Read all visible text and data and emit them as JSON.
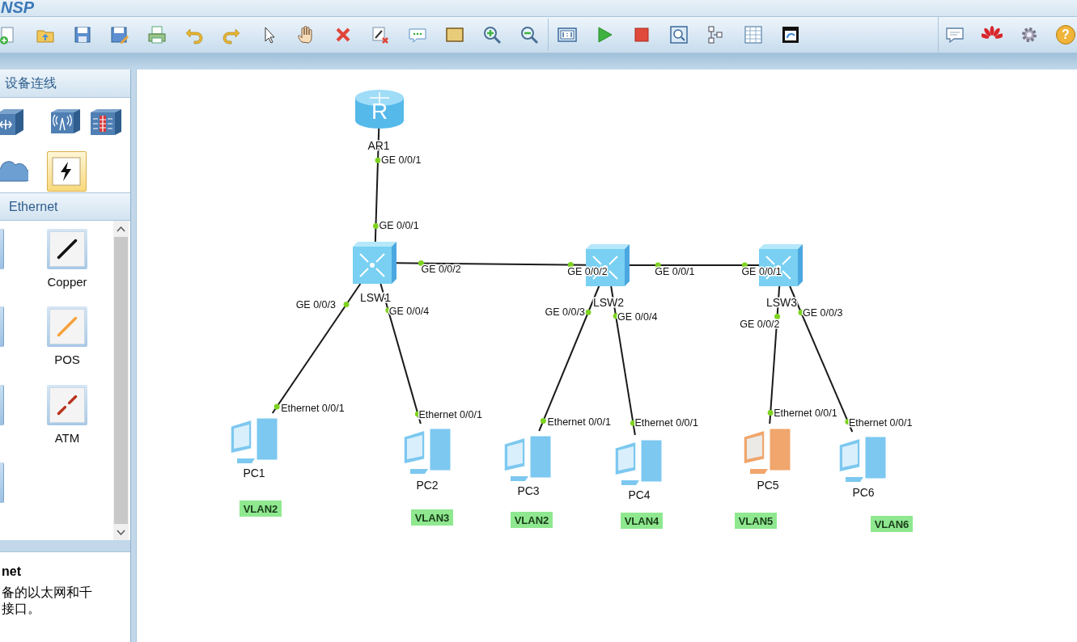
{
  "app": {
    "logo": "NSP"
  },
  "toolbar": {
    "help_glyph": "?"
  },
  "sidebar": {
    "device_header": "设备连线",
    "devices": [
      {
        "kind": "router",
        "selected": false
      },
      {
        "kind": "ap",
        "selected": false
      },
      {
        "kind": "firewall",
        "selected": false
      },
      {
        "kind": "cloud",
        "selected": false
      },
      {
        "kind": "auto-link",
        "selected": true
      }
    ],
    "cable_header": "Ethernet",
    "cables": [
      {
        "kind": "copper",
        "label": "Copper"
      },
      {
        "kind": "pos",
        "label": "POS"
      },
      {
        "kind": "atm",
        "label": "ATM"
      }
    ],
    "description": {
      "title": "net",
      "lines": [
        "备的以太网和千",
        "接口。"
      ]
    }
  },
  "topology": {
    "nodes": [
      {
        "kind": "router",
        "label": "AR1",
        "glyph": "R"
      },
      {
        "kind": "switch",
        "label": "LSW1"
      },
      {
        "kind": "switch",
        "label": "LSW2"
      },
      {
        "kind": "switch",
        "label": "LSW3"
      },
      {
        "kind": "pc",
        "label": "PC1",
        "color": "#7cc8f0"
      },
      {
        "kind": "pc",
        "label": "PC2",
        "color": "#7cc8f0"
      },
      {
        "kind": "pc",
        "label": "PC3",
        "color": "#7cc8f0"
      },
      {
        "kind": "pc",
        "label": "PC4",
        "color": "#7cc8f0"
      },
      {
        "kind": "pc",
        "label": "PC5",
        "color": "#f0a66c"
      },
      {
        "kind": "pc",
        "label": "PC6",
        "color": "#7cc8f0"
      }
    ],
    "links": [
      {
        "ports": [
          "GE 0/0/1",
          "GE 0/0/1"
        ]
      },
      {
        "ports": [
          "GE 0/0/2",
          "GE 0/0/2"
        ]
      },
      {
        "ports": [
          "GE 0/0/1",
          "GE 0/0/1"
        ]
      },
      {
        "ports": [
          "GE 0/0/3",
          "Ethernet 0/0/1"
        ]
      },
      {
        "ports": [
          "GE 0/0/4",
          "Ethernet 0/0/1"
        ]
      },
      {
        "ports": [
          "GE 0/0/3",
          "Ethernet 0/0/1"
        ]
      },
      {
        "ports": [
          "GE 0/0/4",
          "Ethernet 0/0/1"
        ]
      },
      {
        "ports": [
          "GE 0/0/2",
          "Ethernet 0/0/1"
        ]
      },
      {
        "ports": [
          "GE 0/0/3",
          "Ethernet 0/0/1"
        ]
      }
    ],
    "vlan_tags": [
      "VLAN2",
      "VLAN3",
      "VLAN2",
      "VLAN4",
      "VLAN5",
      "VLAN6"
    ]
  }
}
